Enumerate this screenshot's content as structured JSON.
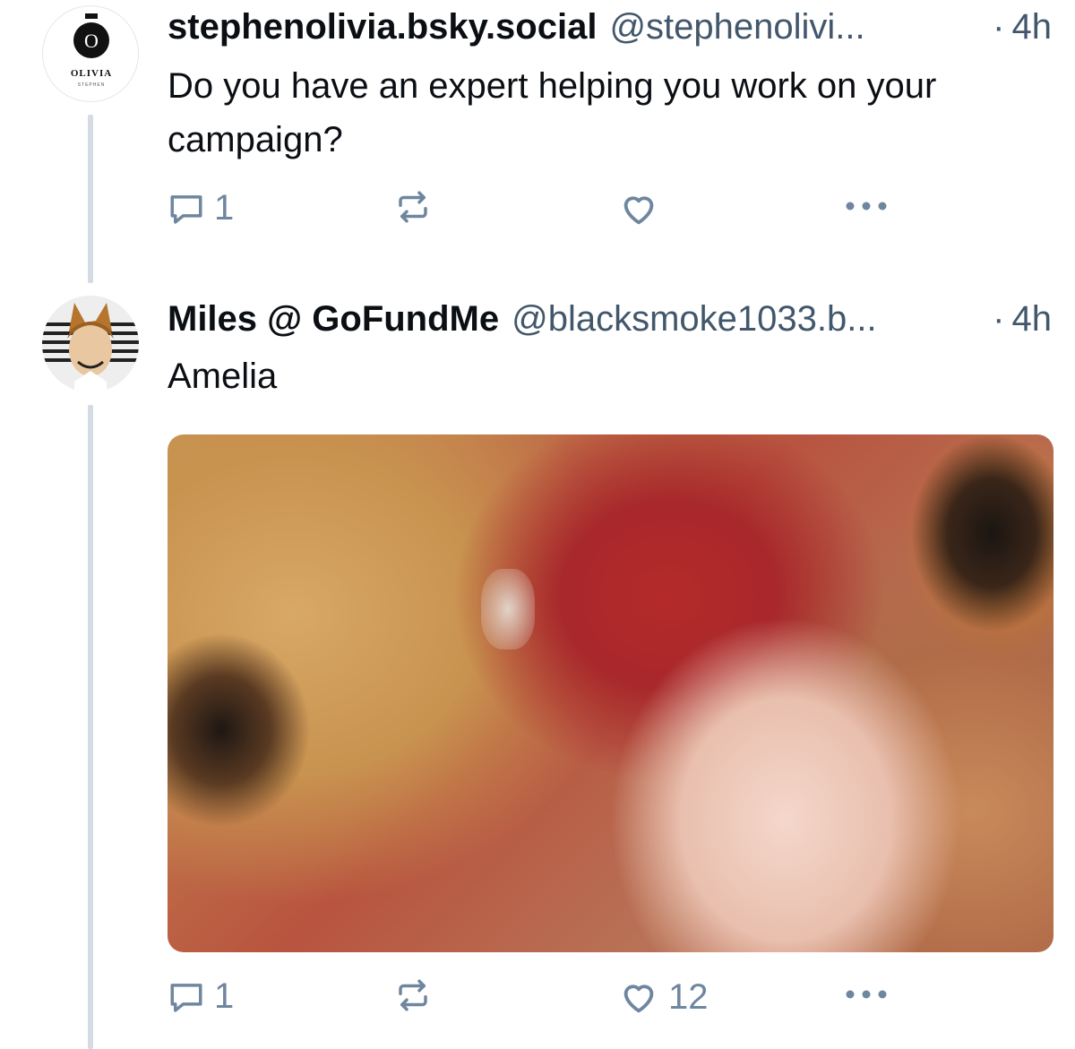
{
  "posts": [
    {
      "display_name": "stephenolivia.bsky.social",
      "handle": "@stephenolivi...",
      "separator": "·",
      "time": "4h",
      "avatar_logo": {
        "letter": "O",
        "name": "OLIVIA",
        "sub": "STEPHEN"
      },
      "text": "Do you have an expert helping you work on your campaign?",
      "reply_count": "1",
      "repost_count": "",
      "like_count": ""
    },
    {
      "display_name": "Miles @ GoFundMe",
      "handle": "@blacksmoke1033.b...",
      "separator": "·",
      "time": "4h",
      "text": "Amelia",
      "reply_count": "1",
      "repost_count": "",
      "like_count": "12"
    }
  ],
  "icons": {
    "reply": "reply-icon",
    "repost": "repost-icon",
    "like": "heart-icon",
    "more": "more-icon"
  },
  "colors": {
    "text": "#0b0f14",
    "muted": "#42576c",
    "icon": "#6f869f",
    "thread_line": "#d4dbe2"
  }
}
